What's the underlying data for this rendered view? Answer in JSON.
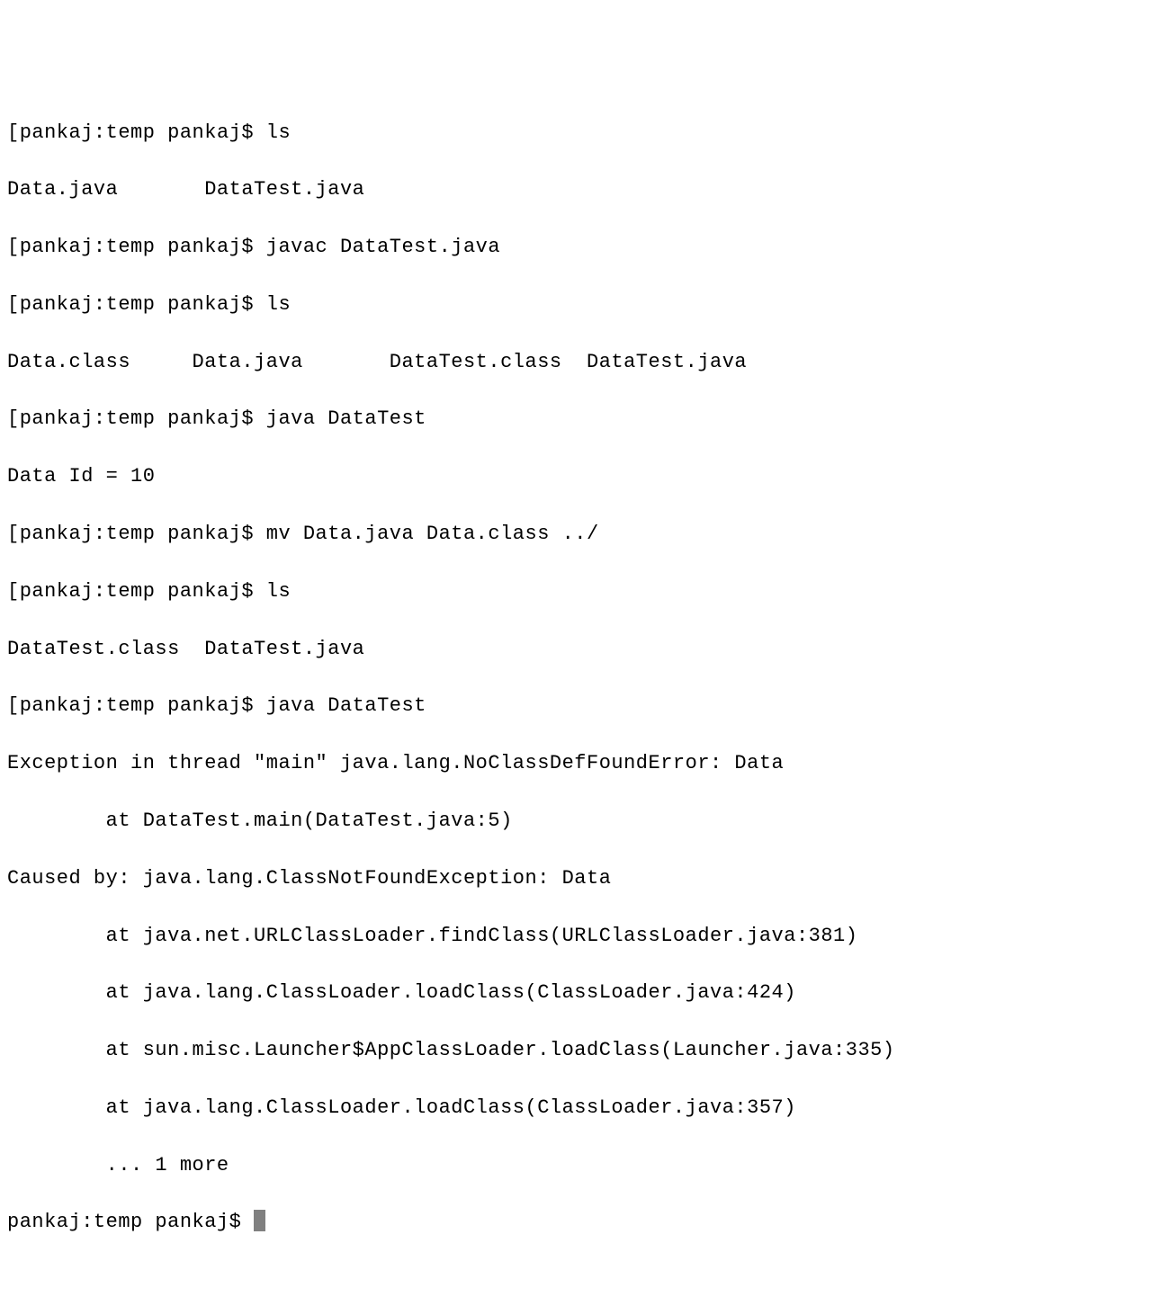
{
  "prompt": "pankaj:temp pankaj$ ",
  "lines": [
    {
      "prefix": "[",
      "prompt": true,
      "cmd": "ls"
    },
    {
      "text": "Data.java       DataTest.java"
    },
    {
      "prefix": "[",
      "prompt": true,
      "cmd": "javac DataTest.java"
    },
    {
      "prefix": "[",
      "prompt": true,
      "cmd": "ls"
    },
    {
      "text": "Data.class     Data.java       DataTest.class  DataTest.java"
    },
    {
      "prefix": "[",
      "prompt": true,
      "cmd": "java DataTest"
    },
    {
      "text": "Data Id = 10"
    },
    {
      "prefix": "[",
      "prompt": true,
      "cmd": "mv Data.java Data.class ../"
    },
    {
      "prefix": "[",
      "prompt": true,
      "cmd": "ls"
    },
    {
      "text": "DataTest.class  DataTest.java"
    },
    {
      "prefix": "[",
      "prompt": true,
      "cmd": "java DataTest"
    },
    {
      "text": "Exception in thread \"main\" java.lang.NoClassDefFoundError: Data"
    },
    {
      "text": "        at DataTest.main(DataTest.java:5)"
    },
    {
      "text": "Caused by: java.lang.ClassNotFoundException: Data"
    },
    {
      "text": "        at java.net.URLClassLoader.findClass(URLClassLoader.java:381)"
    },
    {
      "text": "        at java.lang.ClassLoader.loadClass(ClassLoader.java:424)"
    },
    {
      "text": "        at sun.misc.Launcher$AppClassLoader.loadClass(Launcher.java:335)"
    },
    {
      "text": "        at java.lang.ClassLoader.loadClass(ClassLoader.java:357)"
    },
    {
      "text": "        ... 1 more"
    }
  ],
  "final_prompt_prefix": "",
  "final_prompt": "pankaj:temp pankaj$ "
}
